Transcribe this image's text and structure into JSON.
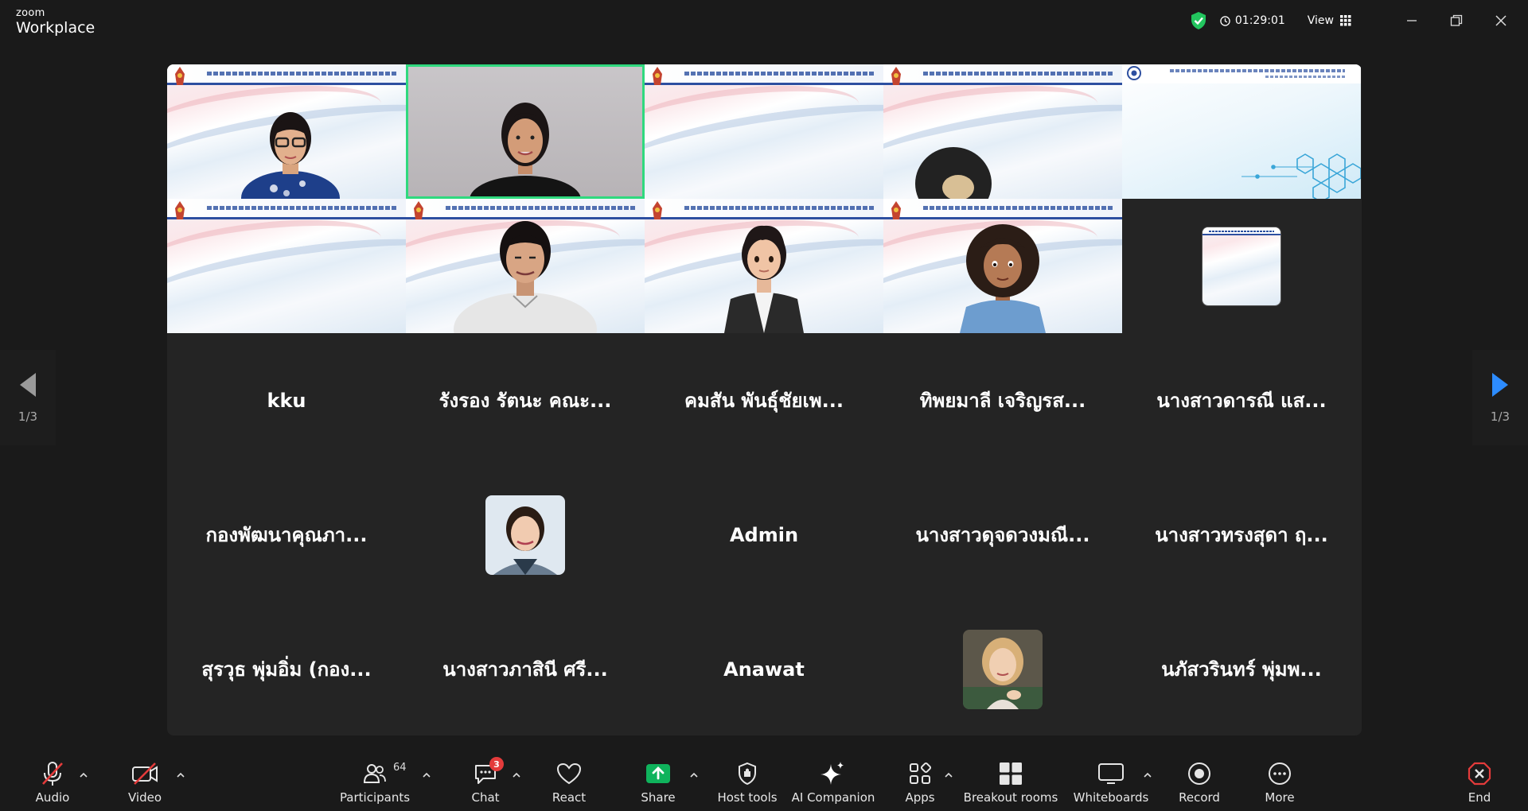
{
  "app": {
    "brand_small": "zoom",
    "brand_name": "Workplace"
  },
  "topbar": {
    "timer": "01:29:01",
    "view_label": "View"
  },
  "gallery": {
    "row3_names": [
      "kku",
      "รังรอง รัตนะ คณะ...",
      "คมสัน พันธุ์ชัยเพ...",
      "ทิพยมาลี เจริญรส...",
      "นางสาวดารณี แส..."
    ],
    "row4_names": [
      "กองพัฒนาคุณภา...",
      "",
      "Admin",
      "นางสาวดุจดวงมณี...",
      "นางสาวทรงสุดา ฤ..."
    ],
    "row5_names": [
      "สุรวุธ พุ่มอิ่ม (กอง...",
      "นางสาวภาสินี ศรี...",
      "Anawat",
      "",
      "นภัสวรินทร์ พุ่มพ..."
    ]
  },
  "pagination": {
    "left_page": "1/3",
    "right_page": "1/3"
  },
  "toolbar": {
    "audio": "Audio",
    "video": "Video",
    "participants": "Participants",
    "participants_count": "64",
    "chat": "Chat",
    "chat_badge": "3",
    "react": "React",
    "share": "Share",
    "host_tools": "Host tools",
    "ai_companion": "AI Companion",
    "apps": "Apps",
    "breakout": "Breakout rooms",
    "whiteboards": "Whiteboards",
    "record": "Record",
    "more": "More",
    "end": "End"
  },
  "colors": {
    "active_speaker": "#2fd97e",
    "share_green": "#0fb35c",
    "end_red": "#e43b3b",
    "nav_arrow": "#2d8cff"
  }
}
